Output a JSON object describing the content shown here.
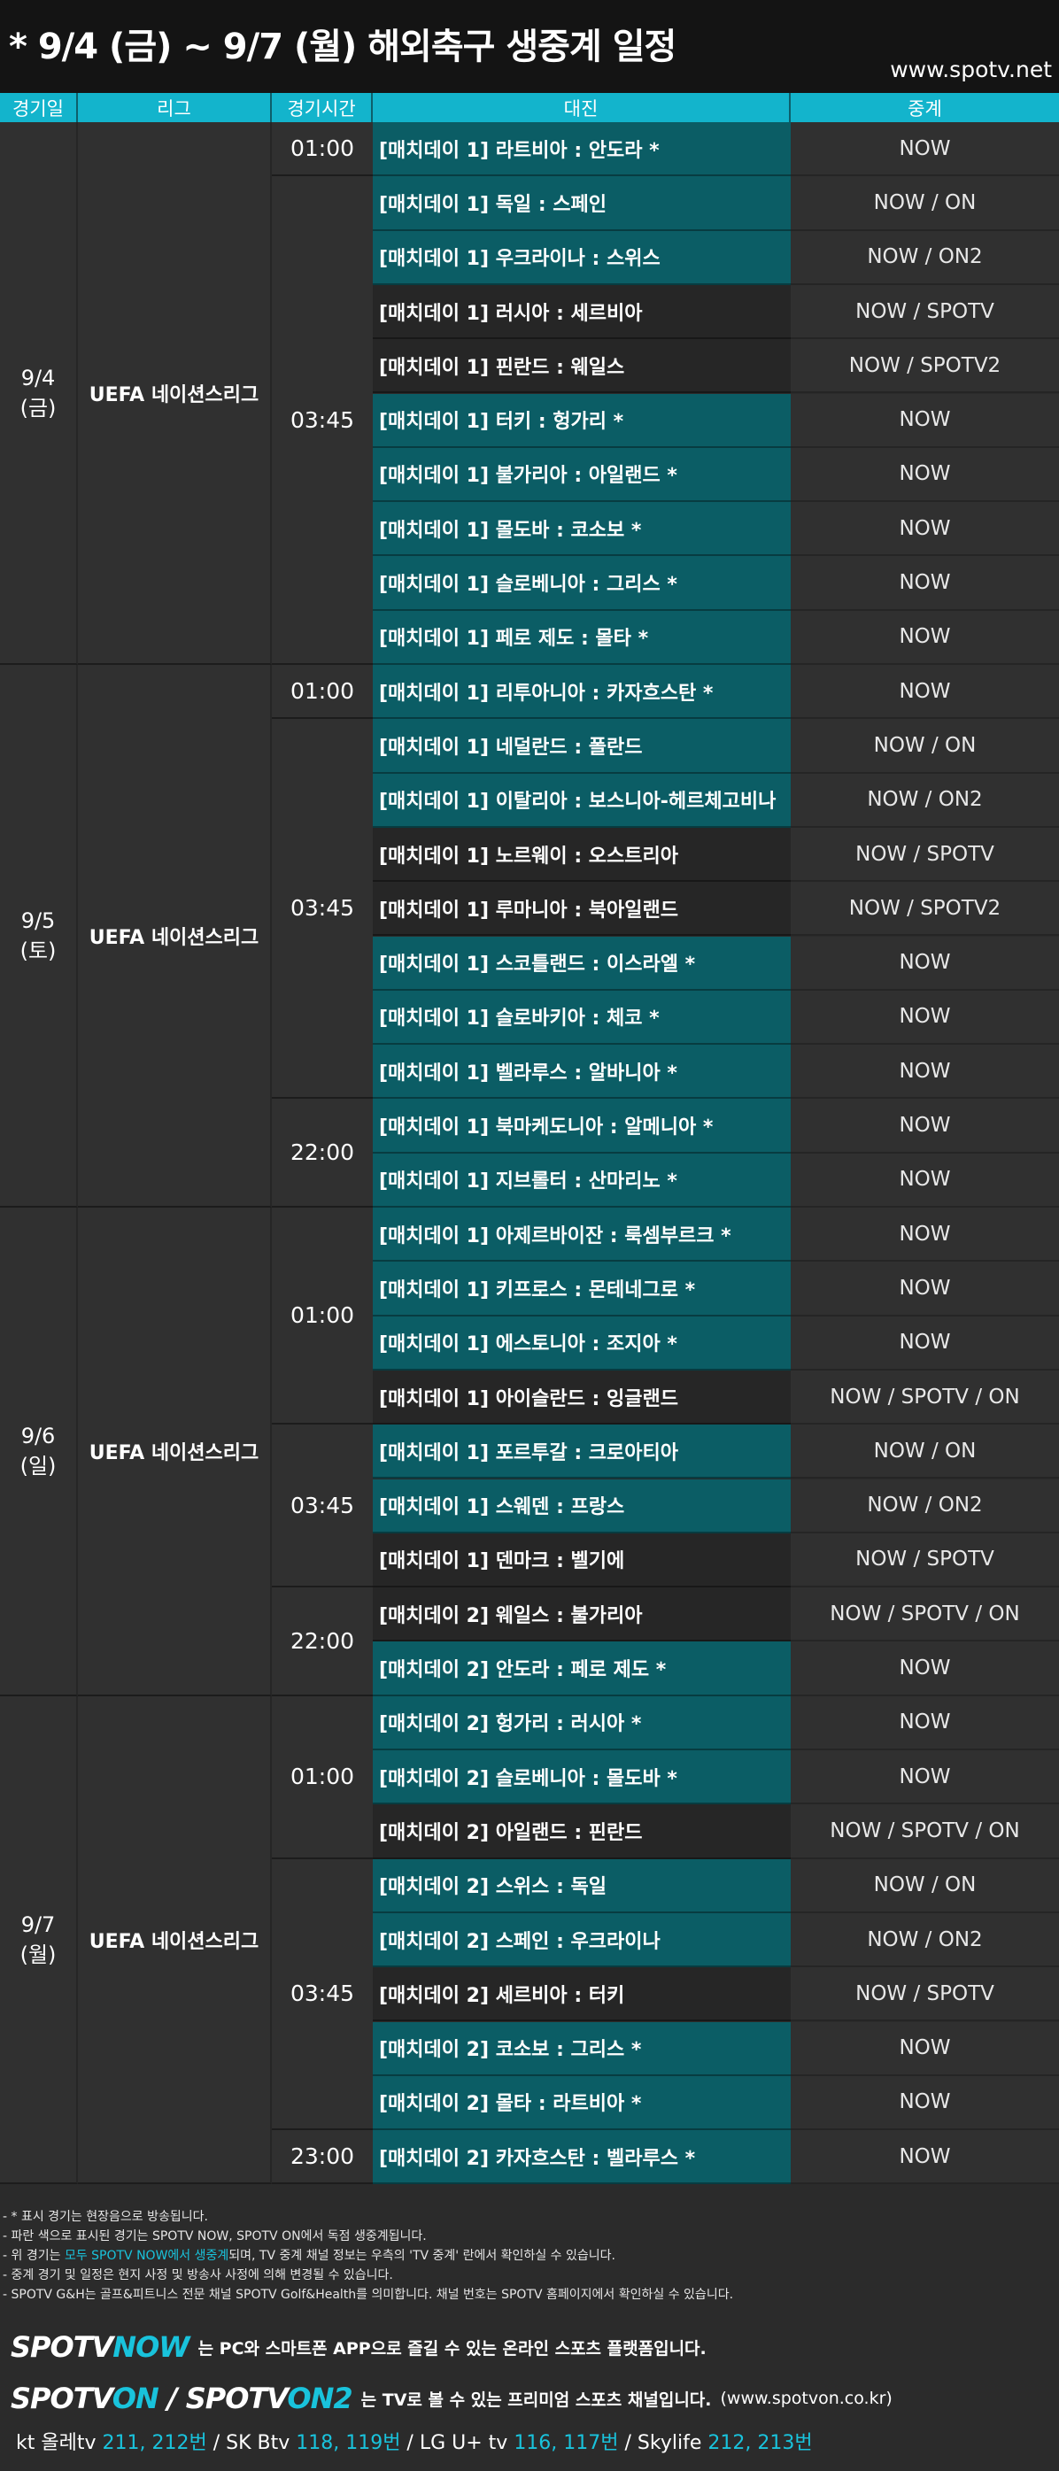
{
  "title": "* 9/4 (금) ~ 9/7 (월) 해외축구 생중계 일정",
  "site": "www.spotv.net",
  "headers": [
    "경기일",
    "리그",
    "경기시간",
    "대진",
    "중계"
  ],
  "days": [
    {
      "date": "9/4\n(금)",
      "league": "UEFA 네이션스리그",
      "start": 0,
      "count": 10
    },
    {
      "date": "9/5\n(토)",
      "league": "UEFA 네이션스리그",
      "start": 10,
      "count": 10
    },
    {
      "date": "9/6\n(일)",
      "league": "UEFA 네이션스리그",
      "start": 20,
      "count": 9
    },
    {
      "date": "9/7\n(월)",
      "league": "UEFA 네이션스리그",
      "start": 29,
      "count": 9
    }
  ],
  "times": [
    {
      "time": "01:00",
      "start": 0,
      "count": 1
    },
    {
      "time": "03:45",
      "start": 1,
      "count": 9
    },
    {
      "time": "01:00",
      "start": 10,
      "count": 1
    },
    {
      "time": "03:45",
      "start": 11,
      "count": 7
    },
    {
      "time": "22:00",
      "start": 18,
      "count": 2
    },
    {
      "time": "01:00",
      "start": 20,
      "count": 4
    },
    {
      "time": "03:45",
      "start": 24,
      "count": 3
    },
    {
      "time": "22:00",
      "start": 27,
      "count": 2
    },
    {
      "time": "01:00",
      "start": 29,
      "count": 3
    },
    {
      "time": "03:45",
      "start": 32,
      "count": 5
    },
    {
      "time": "23:00",
      "start": 37,
      "count": 1
    }
  ],
  "matches": [
    {
      "match": "[매치데이 1] 라트비아 : 안도라 *",
      "broadcast": "NOW",
      "color": "teal"
    },
    {
      "match": "[매치데이 1] 독일 : 스페인",
      "broadcast": "NOW / ON",
      "color": "teal"
    },
    {
      "match": "[매치데이 1] 우크라이나 : 스위스",
      "broadcast": "NOW / ON2",
      "color": "teal"
    },
    {
      "match": "[매치데이 1] 러시아 : 세르비아",
      "broadcast": "NOW / SPOTV",
      "color": "dark"
    },
    {
      "match": "[매치데이 1] 핀란드 : 웨일스",
      "broadcast": "NOW / SPOTV2",
      "color": "dark"
    },
    {
      "match": "[매치데이 1] 터키 : 헝가리 *",
      "broadcast": "NOW",
      "color": "teal"
    },
    {
      "match": "[매치데이 1] 불가리아 : 아일랜드 *",
      "broadcast": "NOW",
      "color": "teal"
    },
    {
      "match": "[매치데이 1] 몰도바 : 코소보 *",
      "broadcast": "NOW",
      "color": "teal"
    },
    {
      "match": "[매치데이 1] 슬로베니아 : 그리스 *",
      "broadcast": "NOW",
      "color": "teal"
    },
    {
      "match": "[매치데이 1] 페로 제도 : 몰타 *",
      "broadcast": "NOW",
      "color": "teal"
    },
    {
      "match": "[매치데이 1] 리투아니아 : 카자흐스탄 *",
      "broadcast": "NOW",
      "color": "teal"
    },
    {
      "match": "[매치데이 1] 네덜란드 : 폴란드",
      "broadcast": "NOW / ON",
      "color": "teal"
    },
    {
      "match": "[매치데이 1] 이탈리아 : 보스니아-헤르체고비나",
      "broadcast": "NOW / ON2",
      "color": "teal"
    },
    {
      "match": "[매치데이 1] 노르웨이 : 오스트리아",
      "broadcast": "NOW / SPOTV",
      "color": "dark"
    },
    {
      "match": "[매치데이 1] 루마니아 : 북아일랜드",
      "broadcast": "NOW / SPOTV2",
      "color": "dark"
    },
    {
      "match": "[매치데이 1] 스코틀랜드 : 이스라엘 *",
      "broadcast": "NOW",
      "color": "teal"
    },
    {
      "match": "[매치데이 1] 슬로바키아 : 체코 *",
      "broadcast": "NOW",
      "color": "teal"
    },
    {
      "match": "[매치데이 1] 벨라루스 : 알바니아 *",
      "broadcast": "NOW",
      "color": "teal"
    },
    {
      "match": "[매치데이 1] 북마케도니아 : 알메니아 *",
      "broadcast": "NOW",
      "color": "teal"
    },
    {
      "match": "[매치데이 1] 지브롤터 : 산마리노 *",
      "broadcast": "NOW",
      "color": "teal"
    },
    {
      "match": "[매치데이 1] 아제르바이잔 : 룩셈부르크 *",
      "broadcast": "NOW",
      "color": "teal"
    },
    {
      "match": "[매치데이 1] 키프로스 : 몬테네그로 *",
      "broadcast": "NOW",
      "color": "teal"
    },
    {
      "match": "[매치데이 1] 에스토니아 : 조지아 *",
      "broadcast": "NOW",
      "color": "teal"
    },
    {
      "match": "[매치데이 1] 아이슬란드 : 잉글랜드",
      "broadcast": "NOW / SPOTV / ON",
      "color": "dark"
    },
    {
      "match": "[매치데이 1] 포르투갈 : 크로아티아",
      "broadcast": "NOW / ON",
      "color": "teal"
    },
    {
      "match": "[매치데이 1] 스웨덴 : 프랑스",
      "broadcast": "NOW / ON2",
      "color": "teal"
    },
    {
      "match": "[매치데이 1] 덴마크 : 벨기에",
      "broadcast": "NOW / SPOTV",
      "color": "dark"
    },
    {
      "match": "[매치데이 2] 웨일스 : 불가리아",
      "broadcast": "NOW / SPOTV / ON",
      "color": "dark"
    },
    {
      "match": "[매치데이 2] 안도라 : 페로 제도 *",
      "broadcast": "NOW",
      "color": "teal"
    },
    {
      "match": "[매치데이 2] 헝가리 : 러시아 *",
      "broadcast": "NOW",
      "color": "teal"
    },
    {
      "match": "[매치데이 2] 슬로베니아 : 몰도바 *",
      "broadcast": "NOW",
      "color": "teal"
    },
    {
      "match": "[매치데이 2] 아일랜드 : 핀란드",
      "broadcast": "NOW / SPOTV / ON",
      "color": "dark"
    },
    {
      "match": "[매치데이 2] 스위스 : 독일",
      "broadcast": "NOW / ON",
      "color": "teal"
    },
    {
      "match": "[매치데이 2] 스페인 : 우크라이나",
      "broadcast": "NOW / ON2",
      "color": "teal"
    },
    {
      "match": "[매치데이 2] 세르비아 : 터키",
      "broadcast": "NOW / SPOTV",
      "color": "dark"
    },
    {
      "match": "[매치데이 2] 코소보 : 그리스 *",
      "broadcast": "NOW",
      "color": "teal"
    },
    {
      "match": "[매치데이 2] 몰타 : 라트비아 *",
      "broadcast": "NOW",
      "color": "teal"
    },
    {
      "match": "[매치데이 2] 카자흐스탄 : 벨라루스 *",
      "broadcast": "NOW",
      "color": "teal"
    }
  ],
  "notes": [
    {
      "text": "- * 표시 경기는 현장음으로 방송됩니다."
    },
    {
      "text": "- 파란 색으로 표시된 경기는 SPOTV NOW, SPOTV ON에서 독점 생중계됩니다."
    },
    {
      "pre": "- 위 경기는 ",
      "hl": "모두 SPOTV NOW에서 생중계",
      "post": "되며, TV 중계 채널 정보는 우측의 'TV 중계' 란에서 확인하실 수 있습니다."
    },
    {
      "text": "- 중계 경기 및 일정은 현지 사정 및 방송사 사정에 의해 변경될 수 있습니다."
    },
    {
      "text": "- SPOTV G&H는 골프&피트니스 전문 채널 SPOTV Golf&Health를 의미합니다. 채널 번호는 SPOTV 홈페이지에서 확인하실 수 있습니다."
    }
  ],
  "promo1": {
    "logo_a": "SPOTV",
    "logo_b": "NOW",
    "text": "는 PC와 스마트폰 APP으로 즐길 수 있는 온라인 스포츠 플랫폼입니다."
  },
  "promo2": {
    "logo_a": "SPOTV",
    "logo_b": "ON",
    "sep": " / ",
    "logo_c": "SPOTV",
    "logo_d": "ON2",
    "text": "는 TV로 볼 수 있는 프리미엄 스포츠 채널입니다.",
    "url": "(www.spotvon.co.kr)"
  },
  "carriers": [
    {
      "name": "kt 올레tv ",
      "num": "211, 212번"
    },
    {
      "name": " / SK Btv ",
      "num": "118, 119번"
    },
    {
      "name": " / LG U+ tv ",
      "num": "116, 117번"
    },
    {
      "name": " / Skylife ",
      "num": "212, 213번"
    }
  ],
  "colors": {
    "accent": "#13b4cc",
    "teal_row": "#0b5d65",
    "dark_row": "#262626"
  }
}
